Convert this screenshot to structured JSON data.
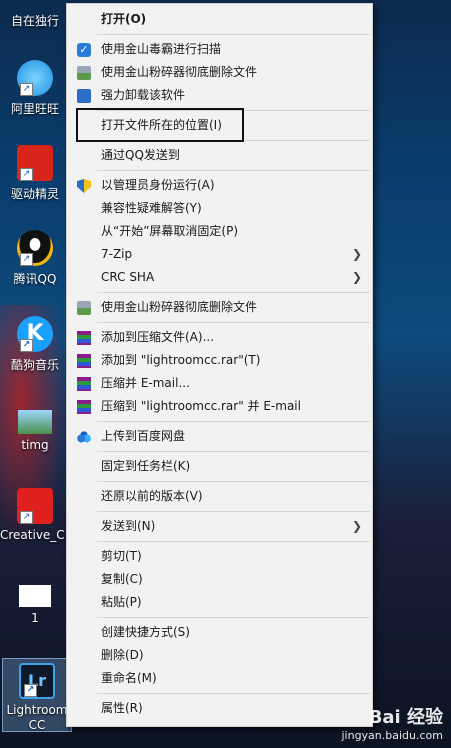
{
  "desktop": {
    "icons": [
      {
        "label": "自在独行"
      },
      {
        "label": "阿里旺旺"
      },
      {
        "label": "驱动精灵"
      },
      {
        "label": "腾讯QQ"
      },
      {
        "label": "酷狗音乐"
      },
      {
        "label": "timg"
      },
      {
        "label": "Creative_C..."
      },
      {
        "label": "1"
      },
      {
        "label": "Lightroom CC"
      }
    ]
  },
  "menu": {
    "items": [
      {
        "label": "打开(O)"
      },
      {
        "label": "使用金山毒霸进行扫描"
      },
      {
        "label": "使用金山粉碎器彻底删除文件"
      },
      {
        "label": "强力卸载该软件"
      },
      {
        "label": "打开文件所在的位置(I)"
      },
      {
        "label": "通过QQ发送到"
      },
      {
        "label": "以管理员身份运行(A)"
      },
      {
        "label": "兼容性疑难解答(Y)"
      },
      {
        "label": "从“开始”屏幕取消固定(P)"
      },
      {
        "label": "7-Zip"
      },
      {
        "label": "CRC SHA"
      },
      {
        "label": "使用金山粉碎器彻底删除文件"
      },
      {
        "label": "添加到压缩文件(A)..."
      },
      {
        "label": "添加到 \"lightroomcc.rar\"(T)"
      },
      {
        "label": "压缩并 E-mail..."
      },
      {
        "label": "压缩到 \"lightroomcc.rar\" 并 E-mail"
      },
      {
        "label": "上传到百度网盘"
      },
      {
        "label": "固定到任务栏(K)"
      },
      {
        "label": "还原以前的版本(V)"
      },
      {
        "label": "发送到(N)"
      },
      {
        "label": "剪切(T)"
      },
      {
        "label": "复制(C)"
      },
      {
        "label": "粘贴(P)"
      },
      {
        "label": "创建快捷方式(S)"
      },
      {
        "label": "删除(D)"
      },
      {
        "label": "重命名(M)"
      },
      {
        "label": "属性(R)"
      }
    ]
  },
  "watermark": {
    "brand": "Bai 经验",
    "url": "jingyan.baidu.com"
  }
}
